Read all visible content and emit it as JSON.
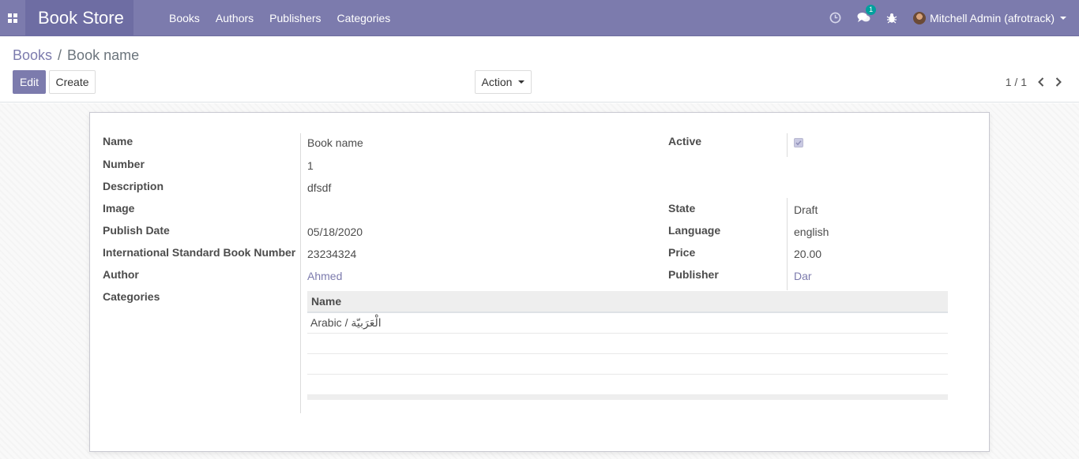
{
  "navbar": {
    "brand": "Book Store",
    "menu": [
      {
        "label": "Books"
      },
      {
        "label": "Authors"
      },
      {
        "label": "Publishers"
      },
      {
        "label": "Categories"
      }
    ],
    "messages_badge": "1",
    "user_name": "Mitchell Admin (afrotrack)"
  },
  "control_panel": {
    "breadcrumb_parent": "Books",
    "breadcrumb_separator": "/",
    "breadcrumb_current": "Book name",
    "edit_label": "Edit",
    "create_label": "Create",
    "action_label": "Action",
    "pager_value": "1 / 1"
  },
  "form": {
    "name_label": "Name",
    "name_value": "Book name",
    "number_label": "Number",
    "number_value": "1",
    "description_label": "Description",
    "description_value": "dfsdf",
    "image_label": "Image",
    "publish_date_label": "Publish Date",
    "publish_date_value": "05/18/2020",
    "isbn_label": "International Standard Book Number",
    "isbn_value": "23234324",
    "author_label": "Author",
    "author_value": "Ahmed",
    "categories_label": "Categories",
    "active_label": "Active",
    "active_checked": true,
    "state_label": "State",
    "state_value": "Draft",
    "language_label": "Language",
    "language_value": "english",
    "price_label": "Price",
    "price_value": "20.00",
    "publisher_label": "Publisher",
    "publisher_value": "Dar"
  },
  "categories_table": {
    "header": "Name",
    "rows": [
      "Arabic / الْعَرَبيّة"
    ]
  },
  "colors": {
    "brand": "#7c7bad",
    "brand_dark": "#6e6da3"
  }
}
